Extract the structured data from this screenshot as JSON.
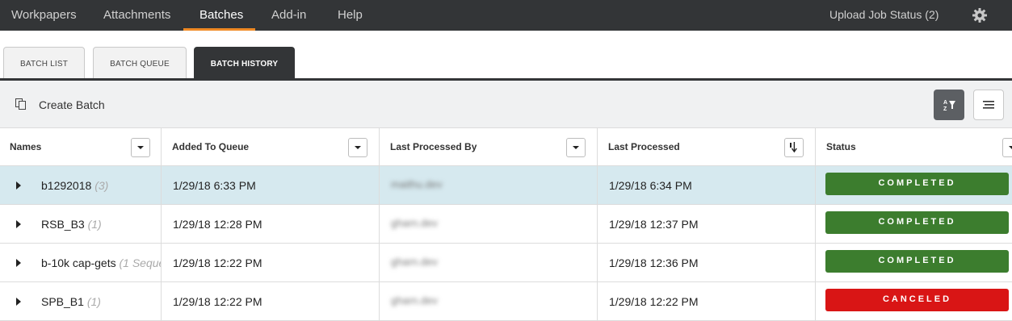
{
  "topnav": {
    "items": [
      "Workpapers",
      "Attachments",
      "Batches",
      "Add-in",
      "Help"
    ],
    "active": "Batches",
    "upload_status": "Upload Job Status (2)",
    "accent": "#f08a24"
  },
  "tabs": [
    "BATCH LIST",
    "BATCH QUEUE",
    "BATCH HISTORY"
  ],
  "toolbar": {
    "create_label": "Create Batch",
    "create_icon": "copy-icon",
    "buttons": [
      "sort-filter-icon",
      "menu-lines-icon"
    ]
  },
  "columns": [
    "Names",
    "Added To Queue",
    "Last Processed By",
    "Last Processed",
    "Status"
  ],
  "rows": [
    {
      "name": "b1292018",
      "count": "(3)",
      "added": "1/29/18 6:33 PM",
      "by": "maithu.dev",
      "last": "1/29/18 6:34 PM",
      "status": "COMPLETED"
    },
    {
      "name": "RSB_B3",
      "count": "(1)",
      "added": "1/29/18 12:28 PM",
      "by": "gharn.dev",
      "last": "1/29/18 12:37 PM",
      "status": "COMPLETED"
    },
    {
      "name": "b-10k cap-gets",
      "count": "(1 Seque",
      "added": "1/29/18 12:22 PM",
      "by": "gharn.dev",
      "last": "1/29/18 12:36 PM",
      "status": "COMPLETED"
    },
    {
      "name": "SPB_B1",
      "count": "(1)",
      "added": "1/29/18 12:22 PM",
      "by": "gharn.dev",
      "last": "1/29/18 12:22 PM",
      "status": "CANCELED"
    }
  ],
  "status_colors": {
    "COMPLETED": "#3c7d2e",
    "CANCELED": "#d91515"
  },
  "selected_row_color": "#d6e9ef"
}
